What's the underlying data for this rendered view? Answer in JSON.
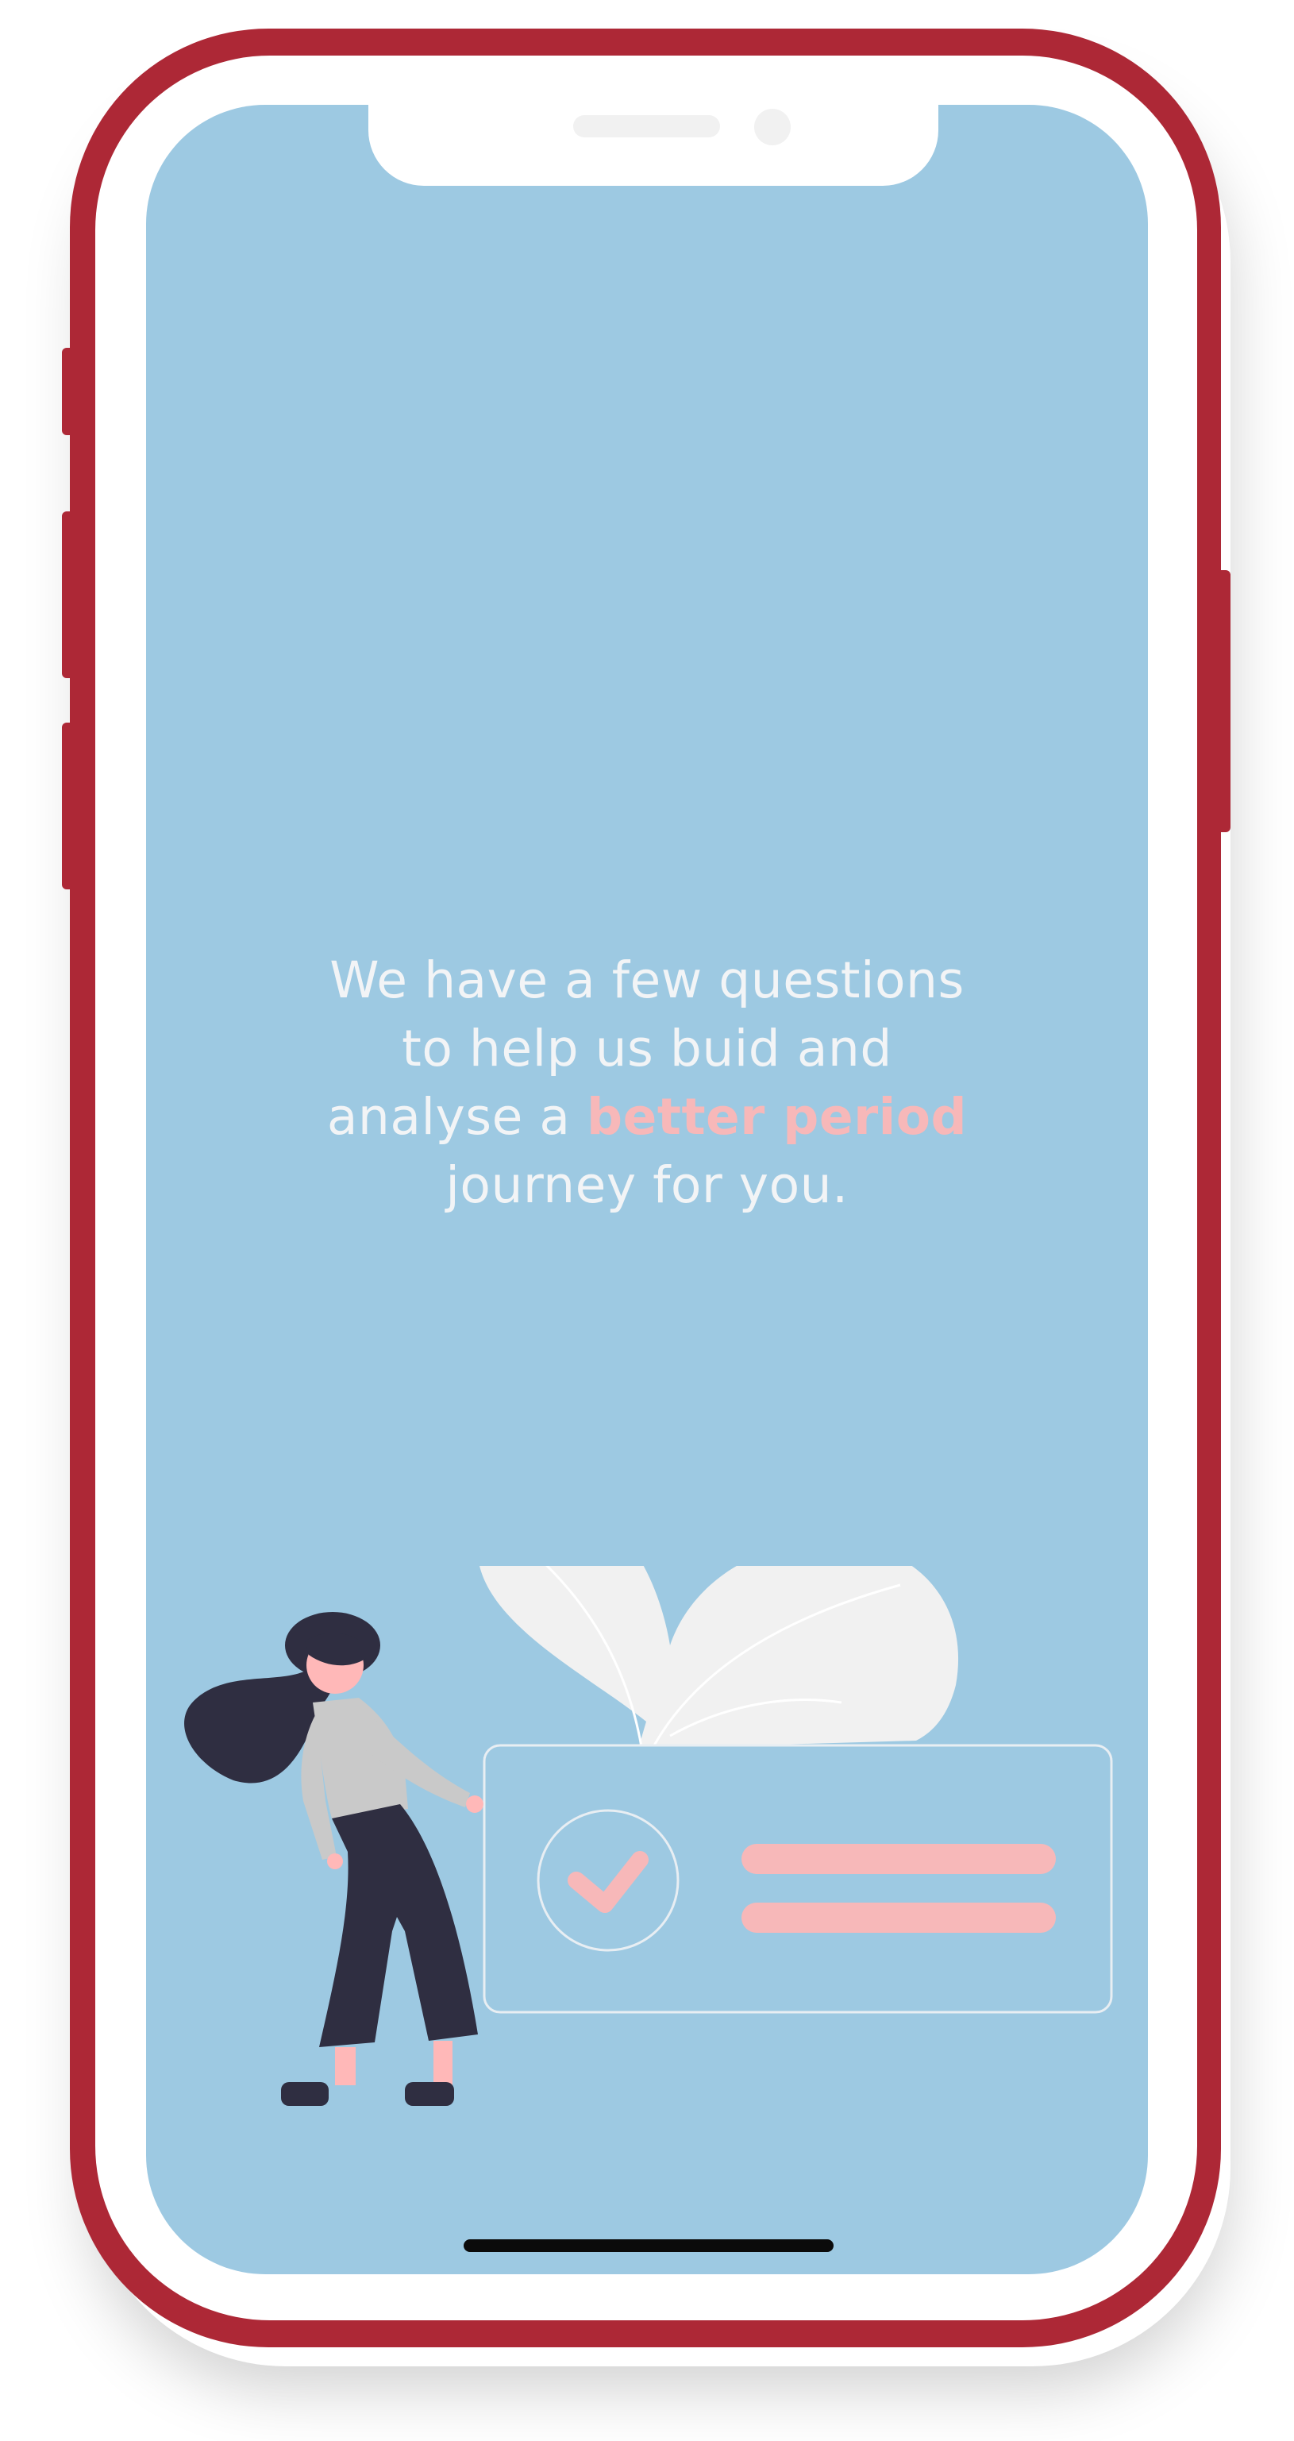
{
  "device": {
    "frame_color": "#ad2836",
    "screen_color": "#9dc9e2"
  },
  "onboarding": {
    "message_line1": "We have a few questions",
    "message_line2": "to help us buid and",
    "message_line3_prefix": "analyse a ",
    "message_highlight": "better period",
    "message_line4": "journey for you.",
    "highlight_color": "#f7b8b9"
  },
  "illustration": {
    "subject": "woman-presenting-checklist-card-icon",
    "leaf": "leaf-icon",
    "check": "check-circle-icon",
    "accent_color": "#f7b8b9"
  }
}
